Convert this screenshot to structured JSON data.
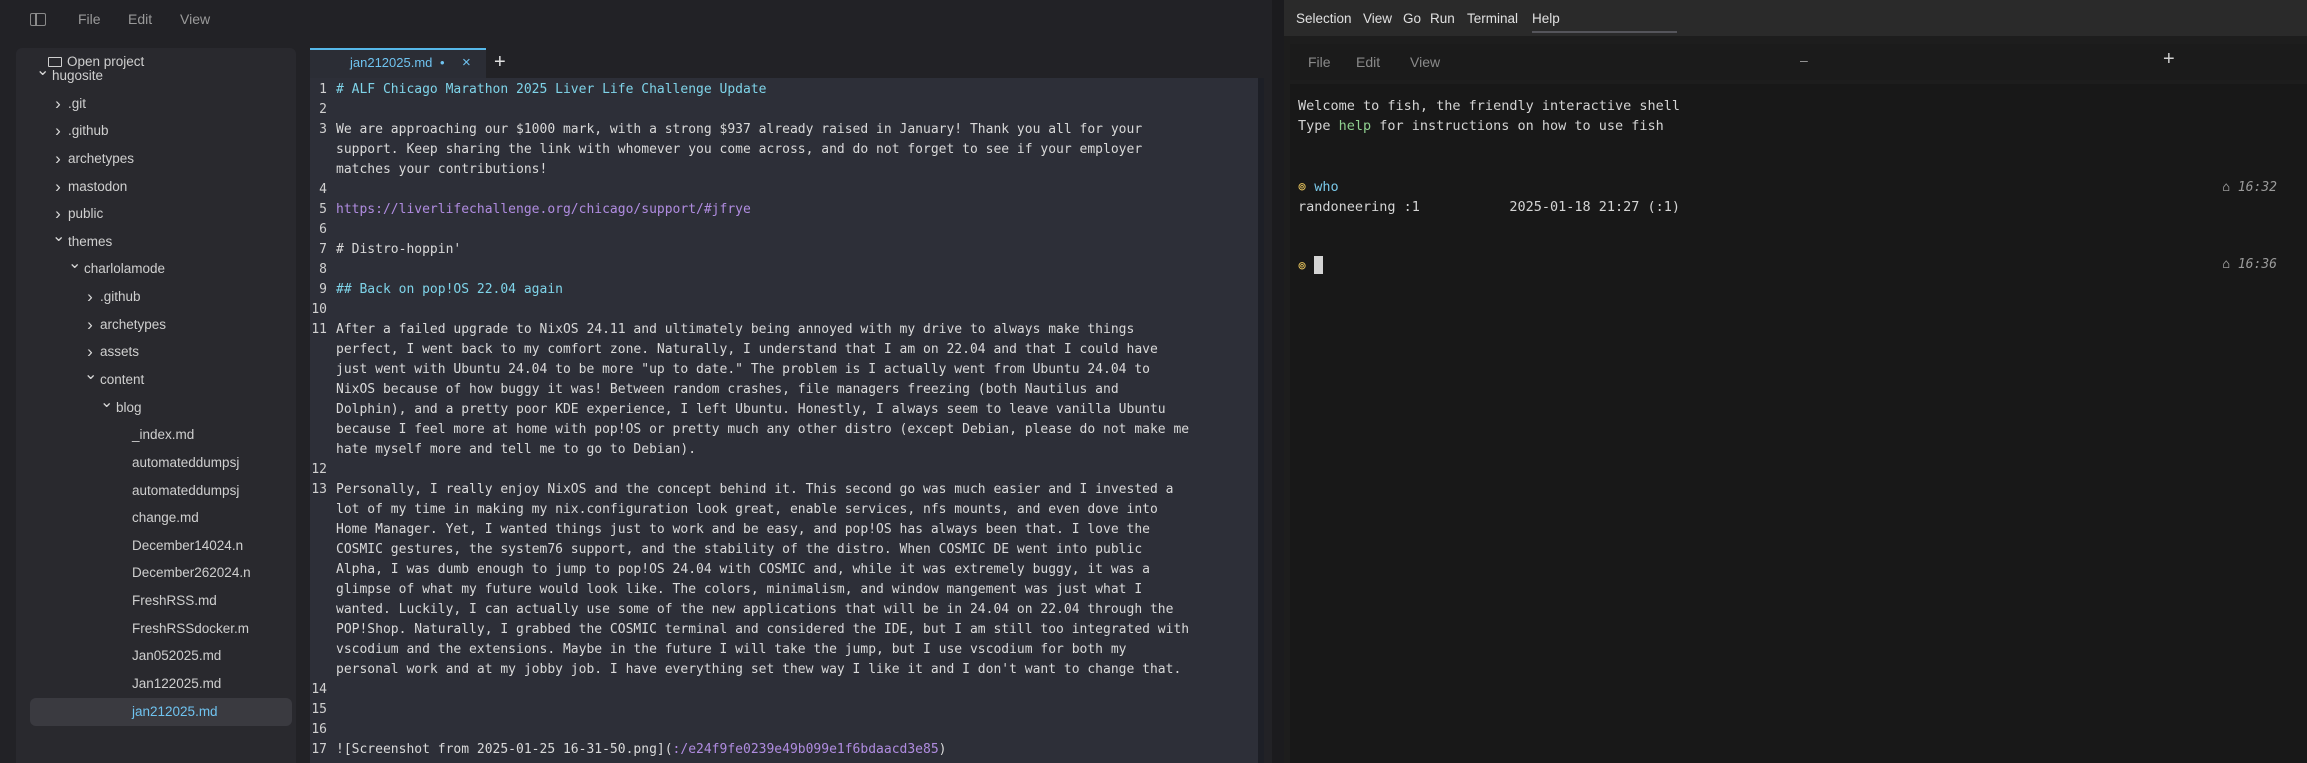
{
  "left_window": {
    "menu": [
      "File",
      "Edit",
      "View"
    ],
    "sidebar": {
      "open_project": "Open project",
      "tree": [
        {
          "label": "hugosite",
          "depth": 0,
          "type": "folder-open"
        },
        {
          "label": ".git",
          "depth": 1,
          "type": "folder"
        },
        {
          "label": ".github",
          "depth": 1,
          "type": "folder"
        },
        {
          "label": "archetypes",
          "depth": 1,
          "type": "folder"
        },
        {
          "label": "mastodon",
          "depth": 1,
          "type": "folder"
        },
        {
          "label": "public",
          "depth": 1,
          "type": "folder"
        },
        {
          "label": "themes",
          "depth": 1,
          "type": "folder-open"
        },
        {
          "label": "charlolamode",
          "depth": 2,
          "type": "folder-open"
        },
        {
          "label": ".github",
          "depth": 3,
          "type": "folder"
        },
        {
          "label": "archetypes",
          "depth": 3,
          "type": "folder"
        },
        {
          "label": "assets",
          "depth": 3,
          "type": "folder"
        },
        {
          "label": "content",
          "depth": 3,
          "type": "folder-open"
        },
        {
          "label": "blog",
          "depth": 4,
          "type": "folder-open"
        },
        {
          "label": "_index.md",
          "depth": 5,
          "type": "file"
        },
        {
          "label": "automateddumpsj",
          "depth": 5,
          "type": "file"
        },
        {
          "label": "automateddumpsj",
          "depth": 5,
          "type": "file"
        },
        {
          "label": "change.md",
          "depth": 5,
          "type": "file"
        },
        {
          "label": "December14024.n",
          "depth": 5,
          "type": "file"
        },
        {
          "label": "December262024.n",
          "depth": 5,
          "type": "file"
        },
        {
          "label": "FreshRSS.md",
          "depth": 5,
          "type": "file"
        },
        {
          "label": "FreshRSSdocker.m",
          "depth": 5,
          "type": "file"
        },
        {
          "label": "Jan052025.md",
          "depth": 5,
          "type": "file"
        },
        {
          "label": "Jan122025.md",
          "depth": 5,
          "type": "file"
        },
        {
          "label": "jan212025.md",
          "depth": 5,
          "type": "file",
          "selected": true
        }
      ]
    },
    "tab": {
      "label": "jan212025.md",
      "dirty": "•",
      "close": "×",
      "add": "+"
    },
    "editor_lines": [
      {
        "n": "1",
        "text": "# ALF Chicago Marathon 2025 Liver Life Challenge Update",
        "kind": "heading",
        "row": 0
      },
      {
        "n": "2",
        "text": "",
        "kind": "plain",
        "row": 1
      },
      {
        "n": "3",
        "text": "We are approaching our $1000 mark, with a strong $937 already raised in January! Thank you all for your\nsupport. Keep sharing the link with whomever you come across, and do not forget to see if your employer\nmatches your contributions!",
        "kind": "plain",
        "row": 2
      },
      {
        "n": "4",
        "text": "",
        "kind": "plain",
        "row": 5
      },
      {
        "n": "5",
        "text": "https://liverlifechallenge.org/chicago/support/#jfrye",
        "kind": "link",
        "row": 6
      },
      {
        "n": "6",
        "text": "",
        "kind": "plain",
        "row": 7
      },
      {
        "n": "7",
        "text": "# Distro-hoppin'",
        "kind": "plain",
        "row": 8
      },
      {
        "n": "8",
        "text": "",
        "kind": "plain",
        "row": 9
      },
      {
        "n": "9",
        "text": "## Back on pop!OS 22.04 again",
        "kind": "heading",
        "row": 10
      },
      {
        "n": "10",
        "text": "",
        "kind": "plain",
        "row": 11
      },
      {
        "n": "11",
        "text": "After a failed upgrade to NixOS 24.11 and ultimately being annoyed with my drive to always make things\nperfect, I went back to my comfort zone. Naturally, I understand that I am on 22.04 and that I could have\njust went with Ubuntu 24.04 to be more \"up to date.\" The problem is I actually went from Ubuntu 24.04 to\nNixOS because of how buggy it was! Between random crashes, file managers freezing (both Nautilus and\nDolphin), and a pretty poor KDE experience, I left Ubuntu. Honestly, I always seem to leave vanilla Ubuntu\nbecause I feel more at home with pop!OS or pretty much any other distro (except Debian, please do not make me\nhate myself more and tell me to go to Debian).",
        "kind": "plain",
        "row": 12
      },
      {
        "n": "12",
        "text": "",
        "kind": "plain",
        "row": 19
      },
      {
        "n": "13",
        "text": "Personally, I really enjoy NixOS and the concept behind it. This second go was much easier and I invested a\nlot of my time in making my nix.configuration look great, enable services, nfs mounts, and even dove into\nHome Manager. Yet, I wanted things just to work and be easy, and pop!OS has always been that. I love the\nCOSMIC gestures, the system76 support, and the stability of the distro. When COSMIC DE went into public\nAlpha, I was dumb enough to jump to pop!OS 24.04 with COSMIC and, while it was extremely buggy, it was a\nglimpse of what my future would look like. The colors, minimalism, and window mangement was just what I\nwanted. Luckily, I can actually use some of the new applications that will be in 24.04 on 22.04 through the\nPOP!Shop. Naturally, I grabbed the COSMIC terminal and considered the IDE, but I am still too integrated with\nvscodium and the extensions. Maybe in the future I will take the jump, but I use vscodium for both my\npersonal work and at my jobby job. I have everything set thew way I like it and I don't want to change that.",
        "kind": "plain",
        "row": 20
      },
      {
        "n": "14",
        "text": "",
        "kind": "plain",
        "row": 30
      },
      {
        "n": "15",
        "text": "",
        "kind": "plain",
        "row": 31
      },
      {
        "n": "16",
        "text": "",
        "kind": "plain",
        "row": 32
      },
      {
        "n": "17",
        "text": "![Screenshot from 2025-01-25 16-31-50.png](",
        "link": ":/e24f9fe0239e49b099e1f6bdaacd3e85",
        "tail": ")",
        "kind": "mixed",
        "row": 33
      }
    ]
  },
  "right_window": {
    "menu": [
      "Selection",
      "View",
      "Go",
      "Run",
      "Terminal",
      "Help"
    ],
    "terminal_menu": [
      "File",
      "Edit",
      "View"
    ],
    "minimize": "–",
    "new_tab": "+",
    "welcome": "Welcome to fish, the friendly interactive shell",
    "help_pre": "Type ",
    "help_word": "help",
    "help_post": " for instructions on how to use fish",
    "prompt_glyph": "⊚",
    "command": "who",
    "who_output": "randoneering :1           2025-01-18 21:27 (:1)",
    "time1": "⌂ 16:32",
    "time2": "⌂ 16:36"
  },
  "colors": {
    "accent": "#57b9e9",
    "heading": "#7fd4e9",
    "link": "#b08ce0",
    "prompt": "#e6c35c"
  }
}
